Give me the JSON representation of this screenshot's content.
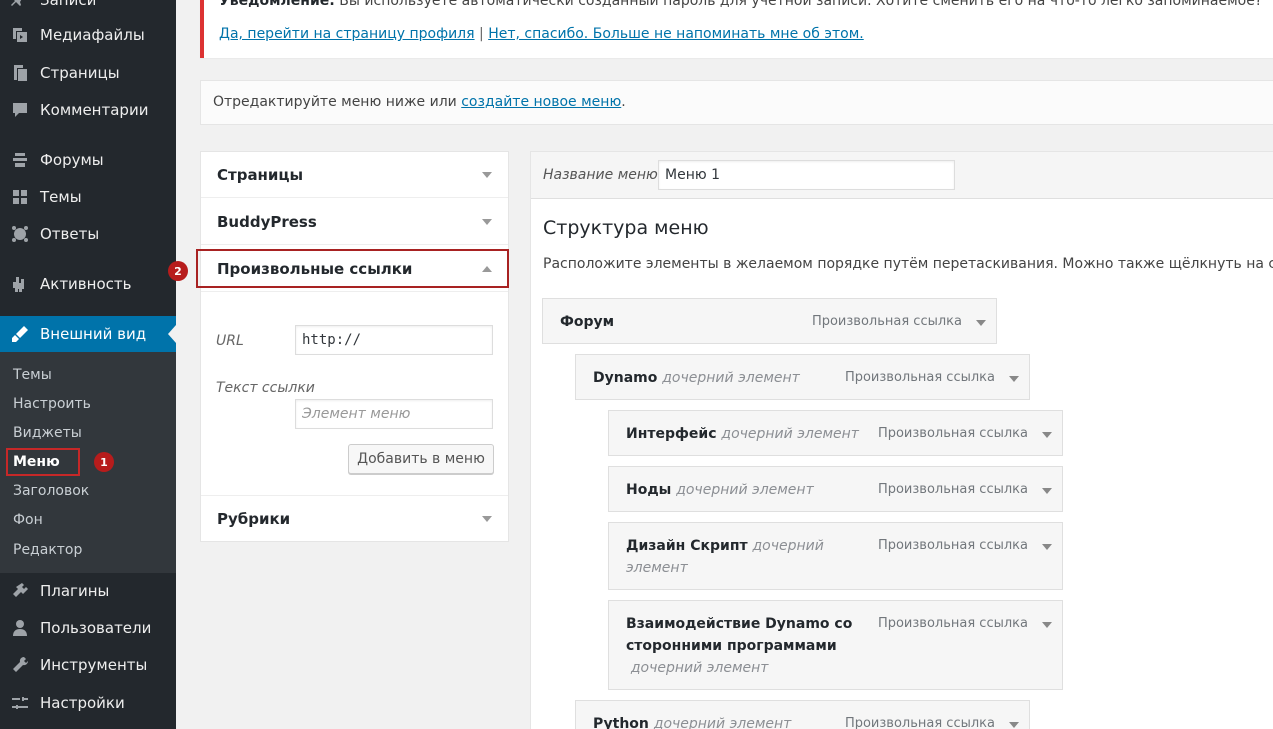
{
  "sidebar": {
    "items": [
      {
        "label": "Записи",
        "icon": "pin-icon"
      },
      {
        "label": "Медиафайлы",
        "icon": "media-icon"
      },
      {
        "label": "Страницы",
        "icon": "pages-icon"
      },
      {
        "label": "Комментарии",
        "icon": "comments-icon"
      },
      {
        "label": "Форумы",
        "icon": "forums-icon"
      },
      {
        "label": "Темы",
        "icon": "topics-icon"
      },
      {
        "label": "Ответы",
        "icon": "replies-icon"
      },
      {
        "label": "Активность",
        "icon": "activity-icon"
      },
      {
        "label": "Внешний вид",
        "icon": "appearance-icon"
      },
      {
        "label": "Плагины",
        "icon": "plugins-icon"
      },
      {
        "label": "Пользователи",
        "icon": "users-icon"
      },
      {
        "label": "Инструменты",
        "icon": "tools-icon"
      },
      {
        "label": "Настройки",
        "icon": "settings-icon"
      }
    ],
    "submenu": [
      "Темы",
      "Настроить",
      "Виджеты",
      "Меню",
      "Заголовок",
      "Фон",
      "Редактор"
    ]
  },
  "annotations": {
    "badge1": "1",
    "badge2": "2"
  },
  "notice": {
    "title": "Уведомление:",
    "text": "Вы используете автоматически созданный пароль для учетной записи. Хотите сменить его на что-то легко запоминаемое?",
    "link_profile": "Да, перейти на страницу профиля",
    "separator": "|",
    "link_dismiss": "Нет, спасибо. Больше не напоминать мне об этом."
  },
  "manage": {
    "text": "Отредактируйте меню ниже или",
    "link": "создайте новое меню",
    "suffix": "."
  },
  "accordion": {
    "pages": "Страницы",
    "buddypress": "BuddyPress",
    "custom_links": "Произвольные ссылки",
    "categories": "Рубрики",
    "url_label": "URL",
    "url_value": "http://",
    "link_text_label": "Текст ссылки",
    "link_text_placeholder": "Элемент меню",
    "add_button": "Добавить в меню"
  },
  "editor": {
    "menu_name_label": "Название меню",
    "menu_name_value": "Меню 1",
    "structure_title": "Структура меню",
    "structure_desc": "Расположите элементы в желаемом порядке путём перетаскивания. Можно также щёлкнуть на стрелку",
    "sub_label": "дочерний элемент",
    "sub_label_wrapped_1": "дочерний",
    "sub_label_wrapped_2": "элемент",
    "item_type": "Произвольная ссылка",
    "items": {
      "forum": "Форум",
      "dynamo": "Dynamo",
      "interface": "Интерфейс",
      "nodes": "Ноды",
      "design_script": "Дизайн Скрипт",
      "interop_line1": "Взаимодействие Dynamo со",
      "interop_line2": "сторонними программами",
      "python": "Python"
    }
  }
}
